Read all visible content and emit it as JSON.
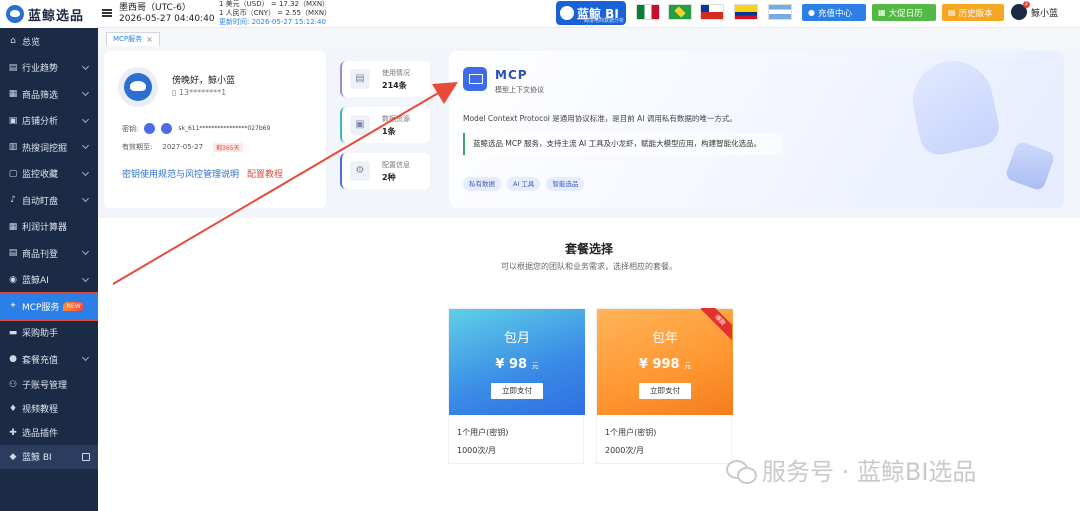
{
  "app": {
    "logo_text": "蓝鲸选品"
  },
  "sidebar": {
    "items": [
      {
        "label": "总览",
        "icon": "home-icon",
        "chev": false
      },
      {
        "label": "行业趋势",
        "icon": "trend-icon",
        "chev": true
      },
      {
        "label": "商品筛选",
        "icon": "grid-icon",
        "chev": true
      },
      {
        "label": "店铺分析",
        "icon": "store-icon",
        "chev": true
      },
      {
        "label": "热搜词挖掘",
        "icon": "fire-icon",
        "chev": true
      },
      {
        "label": "监控收藏",
        "icon": "monitor-icon",
        "chev": true
      },
      {
        "label": "自动盯盘",
        "icon": "bell-icon",
        "chev": true
      },
      {
        "label": "利润计算器",
        "icon": "calculator-icon",
        "chev": false
      },
      {
        "label": "商品刊登",
        "icon": "publish-icon",
        "chev": true
      },
      {
        "label": "蓝鲸AI",
        "icon": "ai-icon",
        "chev": true
      },
      {
        "label": "MCP服务",
        "icon": "mcp-icon",
        "chev": false,
        "badge": "NEW"
      },
      {
        "label": "采购助手",
        "icon": "purchase-icon",
        "chev": false
      },
      {
        "label": "套餐充值",
        "icon": "user-icon",
        "chev": true
      },
      {
        "label": "子账号管理",
        "icon": "team-icon",
        "chev": false
      },
      {
        "label": "视频教程",
        "icon": "video-icon",
        "chev": false
      },
      {
        "label": "选品插件",
        "icon": "puzzle-icon",
        "chev": false
      },
      {
        "label": "蓝鲸 BI",
        "icon": "bi-icon",
        "chev": false
      }
    ]
  },
  "topbar": {
    "timezone": "墨西哥（UTC-6）",
    "datetime": "2026-05-27 04:40:40",
    "rate1": "1 美元（USD） =   17.32（MXN）",
    "rate2": "1 人民币（CNY） =   2.55（MXN）",
    "updated": "更新时间: 2026-05-27 15:12:40",
    "bi_label": "蓝鲸 BI",
    "bi_sub": "跨境电商数据分析专家",
    "recharge": "充值中心",
    "promo": "大促日历",
    "history": "历史版本",
    "username": "鲸小蓝",
    "colors": {
      "recharge": "#2b7fe6",
      "promo": "#52b944",
      "history": "#f5a623"
    }
  },
  "tabs": [
    {
      "label": "MCP服务"
    }
  ],
  "user_card": {
    "greeting": "傍晚好，鲸小蓝",
    "phone": "13********1",
    "key_label": "密钥:",
    "key_value": "sk_611****************027b69",
    "expire_label": "有效期至:",
    "expire_date": "2027-05-27",
    "remain": "剩365天",
    "link1": "密钥使用规范与风控管理说明",
    "link2": "配置教程"
  },
  "stats": [
    {
      "label": "使用情况",
      "value": "214条"
    },
    {
      "label": "数据资源",
      "value": "1条"
    },
    {
      "label": "配置信息",
      "value": "2种"
    }
  ],
  "mcp": {
    "title": "MCP",
    "subtitle": "模型上下文协议",
    "desc": "Model Context Protocol 是通用协议标准，是目前 AI 调用私有数据的唯一方式。",
    "highlight": "蓝鲸选品 MCP 服务，支持主流 AI 工具及小龙虾，赋能大模型应用，构建智能化选品。",
    "chips": [
      "私有数据",
      "AI 工具",
      "智能选品"
    ]
  },
  "plans_section": {
    "title": "套餐选择",
    "subtitle": "可以根据您的团队和业务需求，选择相应的套餐。"
  },
  "plans": [
    {
      "name": "包月",
      "price": "¥ 98",
      "unit": "元",
      "pay": "立即支付",
      "f1": "1个用户(密钥)",
      "f2": "1000次/月"
    },
    {
      "name": "包年",
      "price": "¥ 998",
      "unit": "元",
      "pay": "立即支付",
      "f1": "1个用户(密钥)",
      "f2": "2000次/月",
      "ribbon": "爆款"
    }
  ],
  "watermark": "服务号 · 蓝鲸BI选品"
}
